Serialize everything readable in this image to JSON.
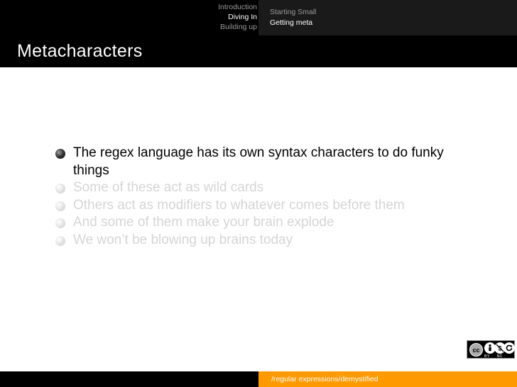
{
  "nav": {
    "sections": [
      {
        "label": "Introduction",
        "current": false
      },
      {
        "label": "Diving In",
        "current": true
      },
      {
        "label": "Building up",
        "current": false
      }
    ],
    "subsections": [
      {
        "label": "Starting Small",
        "current": false
      },
      {
        "label": "Getting meta",
        "current": true
      }
    ]
  },
  "frame": {
    "title": "Metacharacters"
  },
  "bullets": [
    {
      "text": "The regex language has its own syntax characters to do funky things",
      "active": true
    },
    {
      "text": "Some of these act as wild cards",
      "active": false
    },
    {
      "text": "Others act as modifiers to whatever comes before them",
      "active": false
    },
    {
      "text": "And some of them make your brain explode",
      "active": false
    },
    {
      "text": "We won’t be blowing up brains today",
      "active": false
    }
  ],
  "license": {
    "badge_icon": "cc-icon",
    "icons": [
      "by-icon",
      "nc-icon",
      "sa-icon"
    ],
    "cc_text": "cc",
    "labels": [
      "BY",
      "NC",
      "SA"
    ]
  },
  "footer": {
    "text": "/regular expressions/demystified"
  },
  "colors": {
    "header_bg": "#000000",
    "subsection_bg": "#1a1a1a",
    "footer_accent": "#ff9900",
    "dim_text": "#d5d5d5"
  }
}
